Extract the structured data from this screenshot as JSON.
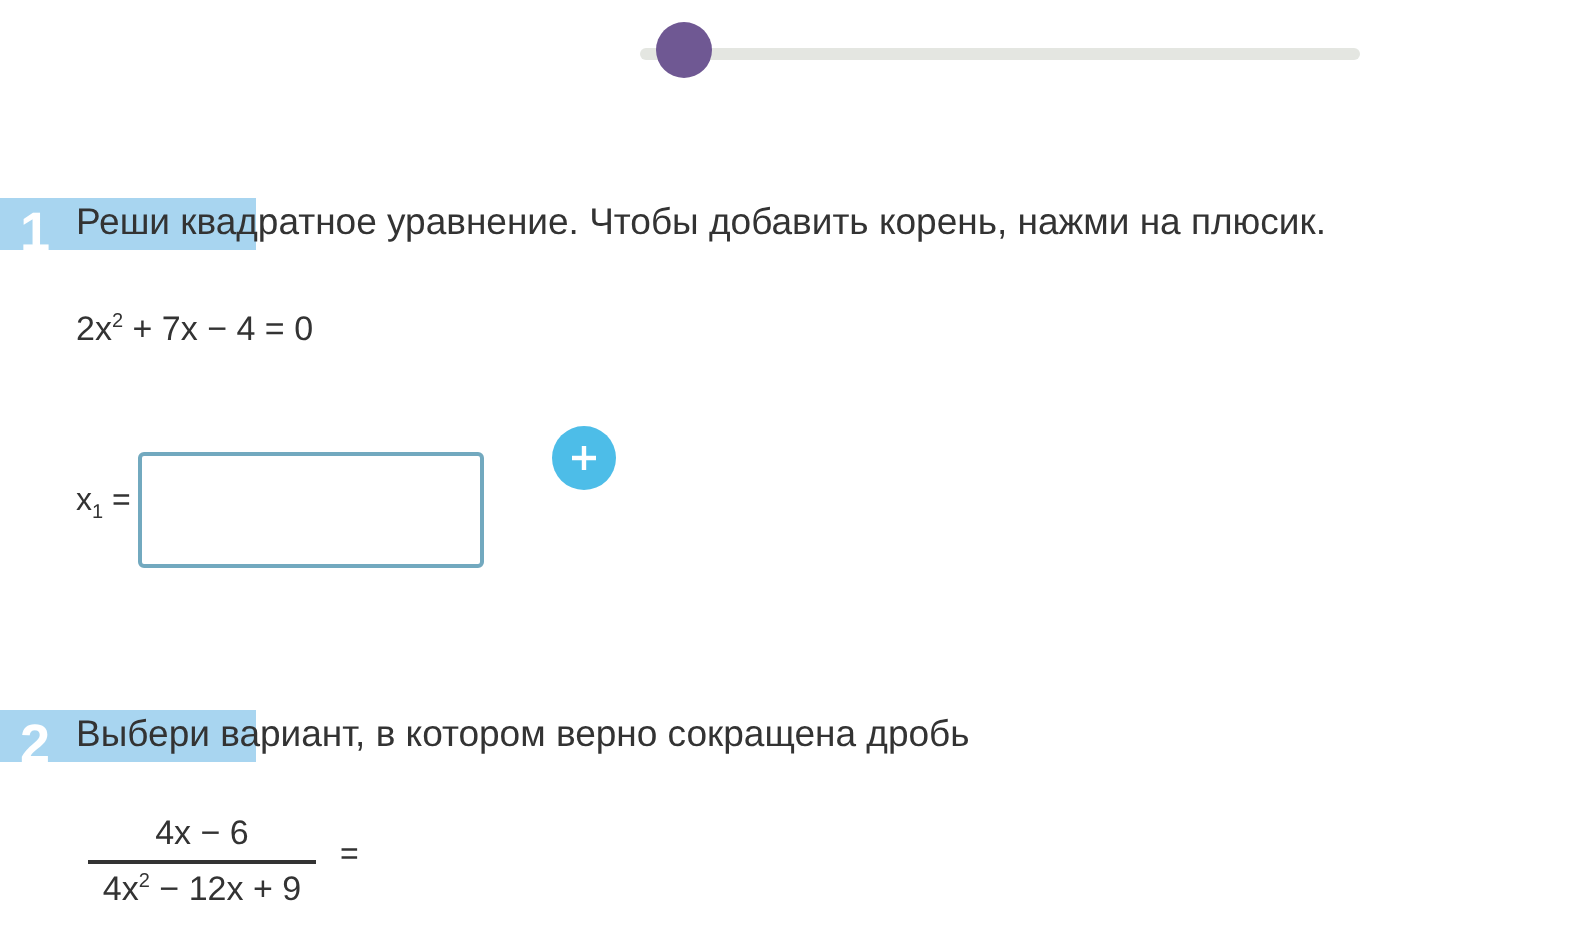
{
  "progress": {
    "level": 0.06
  },
  "tasks": [
    {
      "number": "1",
      "prompt": "Реши квадратное уравнение. Чтобы добавить корень, нажми на плюсик.",
      "equation": "2x$^{2}$ + 7x − 4 = 0",
      "answers": [
        {
          "label": "x$_{1}$ ="
        }
      ],
      "add_button": true
    },
    {
      "number": "2",
      "prompt": "Выбери вариант, в котором верно сокращена дробь",
      "fraction": {
        "numerator": "4x − 6",
        "denominator": "4x$^{2}$ − 12x + 9",
        "relation": "="
      }
    }
  ]
}
